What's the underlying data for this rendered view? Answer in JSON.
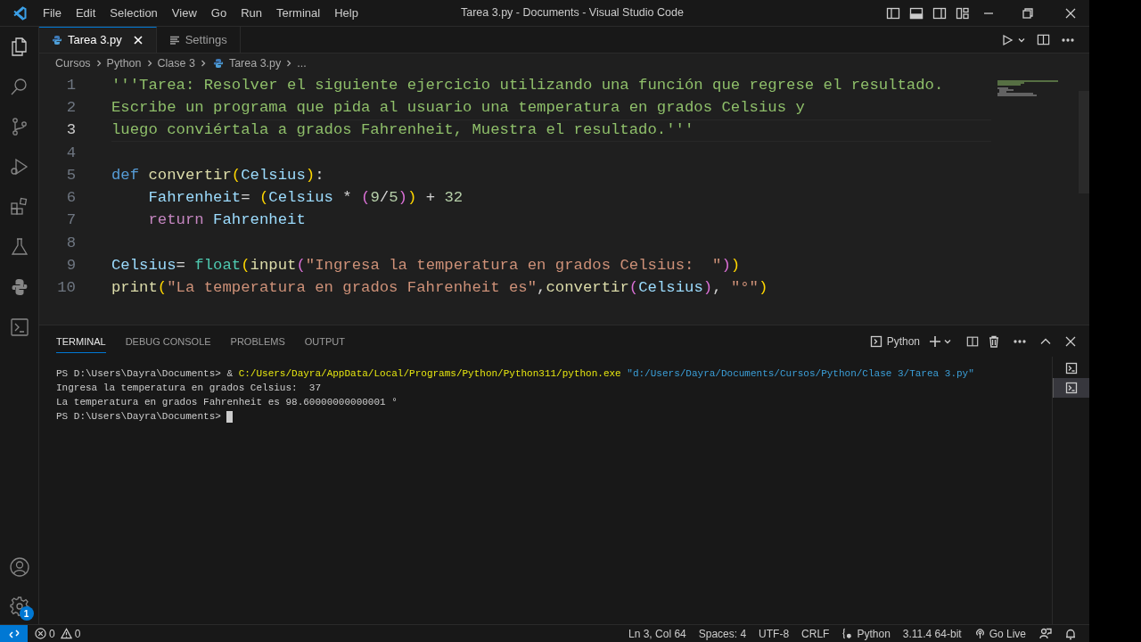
{
  "title_bar": {
    "menu": [
      "File",
      "Edit",
      "Selection",
      "View",
      "Go",
      "Run",
      "Terminal",
      "Help"
    ],
    "title": "Tarea 3.py - Documents - Visual Studio Code"
  },
  "activity_badge": "1",
  "tabs": [
    {
      "label": "Tarea 3.py",
      "kind": "python",
      "selected": true
    },
    {
      "label": "Settings",
      "kind": "settings",
      "selected": false
    }
  ],
  "breadcrumb": [
    "Cursos",
    "Python",
    "Clase 3",
    "Tarea 3.py",
    "..."
  ],
  "editor": {
    "lines": [
      {
        "number": "1",
        "current": false,
        "tokens": [
          {
            "kind": "docstring",
            "text": "'''Tarea: Resolver el siguiente ejercicio utilizando una función que regrese el resultado."
          }
        ]
      },
      {
        "number": "2",
        "current": false,
        "tokens": [
          {
            "kind": "docstring",
            "text": "Escribe un programa que pida al usuario una temperatura en grados Celsius y"
          }
        ]
      },
      {
        "number": "3",
        "current": true,
        "tokens": [
          {
            "kind": "docstring",
            "text": "luego conviértala a grados Fahrenheit, Muestra el resultado.'''"
          }
        ]
      },
      {
        "number": "4",
        "current": false
      },
      {
        "number": "5",
        "current": false,
        "tokens": [
          {
            "kind": "keyword",
            "text": "def "
          },
          {
            "kind": "function",
            "text": "convertir"
          },
          {
            "kind": "bracket1",
            "text": "("
          },
          {
            "kind": "variable",
            "text": "Celsius"
          },
          {
            "kind": "bracket1",
            "text": ")"
          },
          {
            "kind": "plain",
            "text": ":"
          }
        ]
      },
      {
        "number": "6",
        "current": false,
        "tokens": [
          {
            "kind": "variable",
            "text": "    Fahrenheit"
          },
          {
            "kind": "plain",
            "text": "= "
          },
          {
            "kind": "bracket1",
            "text": "("
          },
          {
            "kind": "variable",
            "text": "Celsius"
          },
          {
            "kind": "plain",
            "text": " * "
          },
          {
            "kind": "bracket2",
            "text": "("
          },
          {
            "kind": "number",
            "text": "9"
          },
          {
            "kind": "plain",
            "text": "/"
          },
          {
            "kind": "number",
            "text": "5"
          },
          {
            "kind": "bracket2",
            "text": ")"
          },
          {
            "kind": "bracket1",
            "text": ")"
          },
          {
            "kind": "plain",
            "text": " + "
          },
          {
            "kind": "number",
            "text": "32"
          }
        ]
      },
      {
        "number": "7",
        "current": false,
        "tokens": [
          {
            "kind": "control",
            "text": "    return "
          },
          {
            "kind": "variable",
            "text": "Fahrenheit"
          }
        ]
      },
      {
        "number": "8",
        "current": false
      },
      {
        "number": "9",
        "current": false,
        "tokens": [
          {
            "kind": "variable",
            "text": "Celsius"
          },
          {
            "kind": "plain",
            "text": "= "
          },
          {
            "kind": "type",
            "text": "float"
          },
          {
            "kind": "bracket1",
            "text": "("
          },
          {
            "kind": "function",
            "text": "input"
          },
          {
            "kind": "bracket2",
            "text": "("
          },
          {
            "kind": "string",
            "text": "\"Ingresa la temperatura en grados Celsius:  \""
          },
          {
            "kind": "bracket2",
            "text": ")"
          },
          {
            "kind": "bracket1",
            "text": ")"
          }
        ]
      },
      {
        "number": "10",
        "current": false,
        "tokens": [
          {
            "kind": "function",
            "text": "print"
          },
          {
            "kind": "bracket1",
            "text": "("
          },
          {
            "kind": "string",
            "text": "\"La temperatura en grados Fahrenheit es\""
          },
          {
            "kind": "plain",
            "text": ","
          },
          {
            "kind": "function",
            "text": "convertir"
          },
          {
            "kind": "bracket2",
            "text": "("
          },
          {
            "kind": "variable",
            "text": "Celsius"
          },
          {
            "kind": "bracket2",
            "text": ")"
          },
          {
            "kind": "plain",
            "text": ", "
          },
          {
            "kind": "string",
            "text": "\"°\""
          },
          {
            "kind": "bracket1",
            "text": ")"
          }
        ]
      }
    ]
  },
  "panel": {
    "tabs": [
      {
        "label": "TERMINAL",
        "selected": true
      },
      {
        "label": "DEBUG CONSOLE",
        "selected": false
      },
      {
        "label": "PROBLEMS",
        "selected": false
      },
      {
        "label": "OUTPUT",
        "selected": false
      }
    ],
    "shell": "Python",
    "terminal_lines": [
      {
        "cursor": false,
        "tokens": [
          {
            "kind": "plain",
            "text": "PS D:\\Users\\Dayra\\Documents> & "
          },
          {
            "kind": "command",
            "text": "C:/Users/Dayra/AppData/Local/Programs/Python/Python311/python.exe"
          },
          {
            "kind": "argument",
            "text": " \"d:/Users/Dayra/Documents/Cursos/Python/Clase 3/Tarea 3.py\""
          }
        ]
      },
      {
        "cursor": false,
        "tokens": [
          {
            "kind": "plain",
            "text": "Ingresa la temperatura en grados Celsius:  37"
          }
        ]
      },
      {
        "cursor": false,
        "tokens": [
          {
            "kind": "plain",
            "text": "La temperatura en grados Fahrenheit es 98.60000000000001 °"
          }
        ]
      },
      {
        "cursor": true,
        "tokens": [
          {
            "kind": "plain",
            "text": "PS D:\\Users\\Dayra\\Documents> "
          }
        ]
      }
    ],
    "terminals": [
      {
        "selected": false
      },
      {
        "selected": true
      }
    ]
  },
  "status_bar": {
    "errors": "0",
    "warnings": "0",
    "items": [
      {
        "kind": "text",
        "text": "Ln 3, Col 64"
      },
      {
        "kind": "text",
        "text": "Spaces: 4"
      },
      {
        "kind": "text",
        "text": "UTF-8"
      },
      {
        "kind": "text",
        "text": "CRLF"
      },
      {
        "kind": "language",
        "text": "Python"
      },
      {
        "kind": "text",
        "text": "3.11.4 64-bit"
      },
      {
        "kind": "live",
        "text": "Go Live"
      }
    ]
  }
}
